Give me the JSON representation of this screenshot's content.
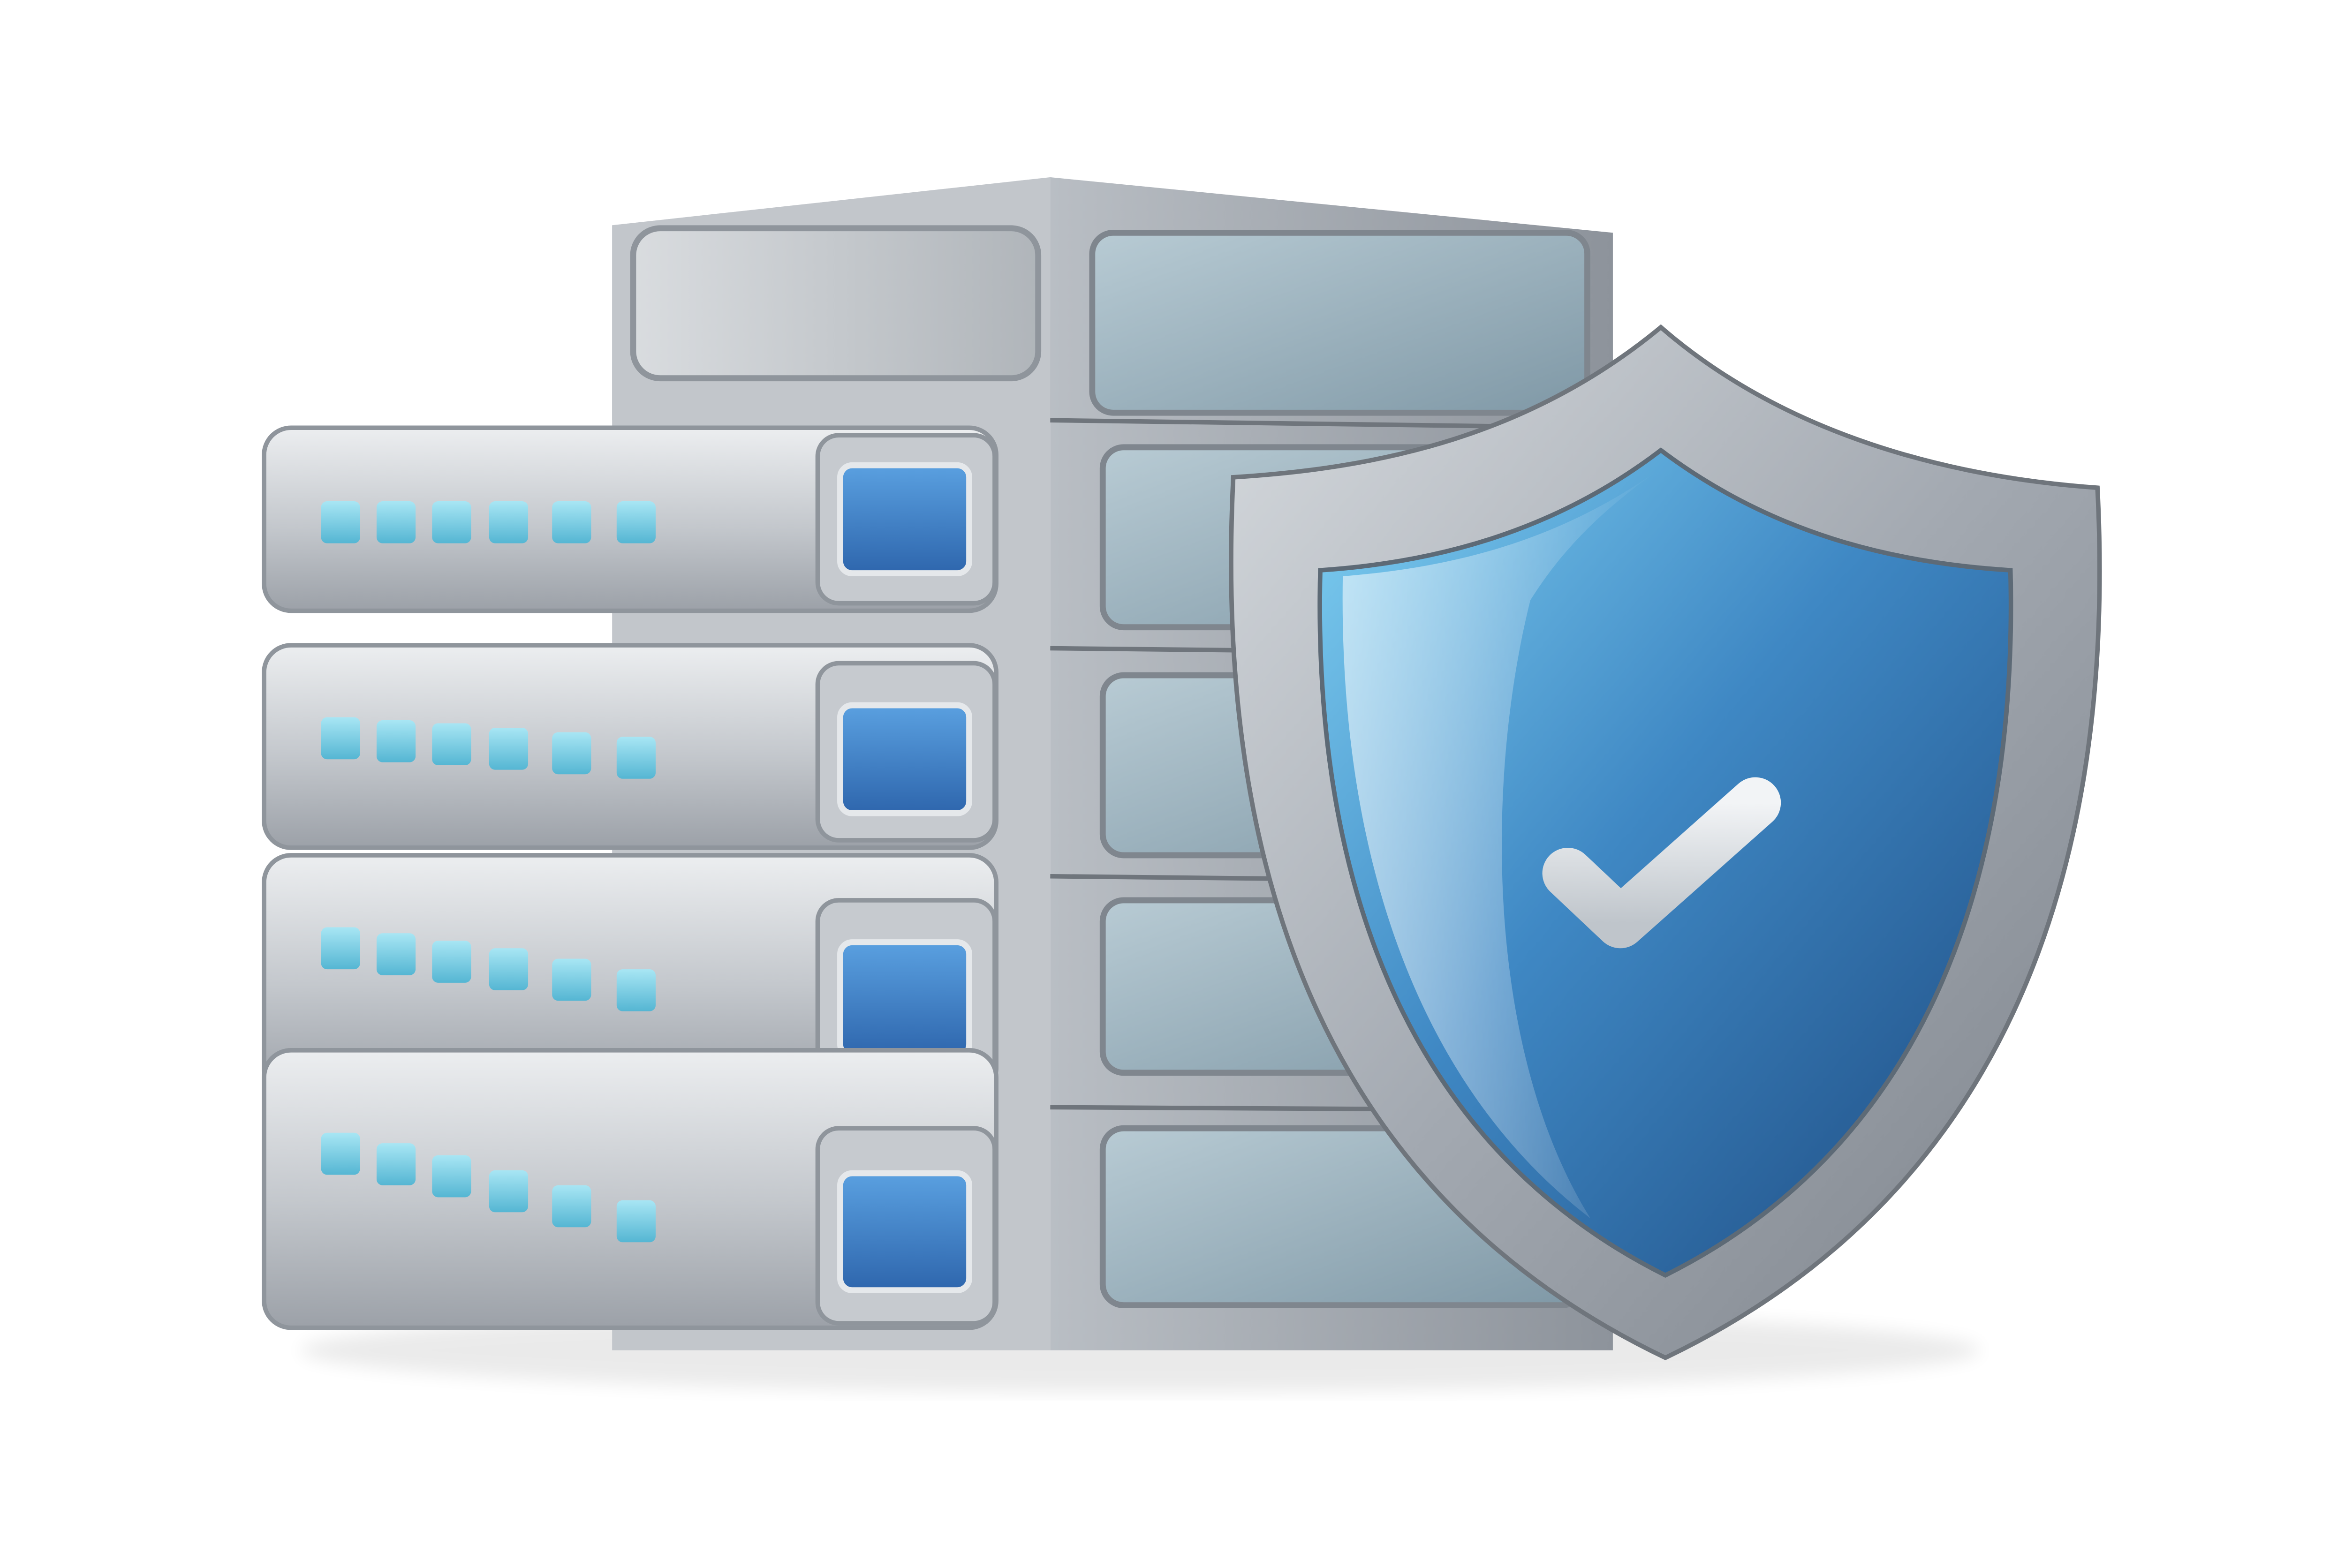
{
  "illustration": {
    "subject": "server-security-illustration",
    "icons": [
      "server-rack-icon",
      "shield-icon",
      "checkmark-icon"
    ],
    "server_units": 4,
    "leds_per_unit": 6,
    "colors": {
      "background": "#ffffff",
      "metal_light": "#d8dbdf",
      "metal_mid": "#a9aeb5",
      "metal_dark": "#7d838b",
      "glass": "#9fb8c4",
      "led": "#7fd3e8",
      "button_blue": "#3f7fc6",
      "shield_blue_light": "#6fc6ec",
      "shield_blue_dark": "#1f4f86",
      "check": "#dfe3e7"
    }
  }
}
